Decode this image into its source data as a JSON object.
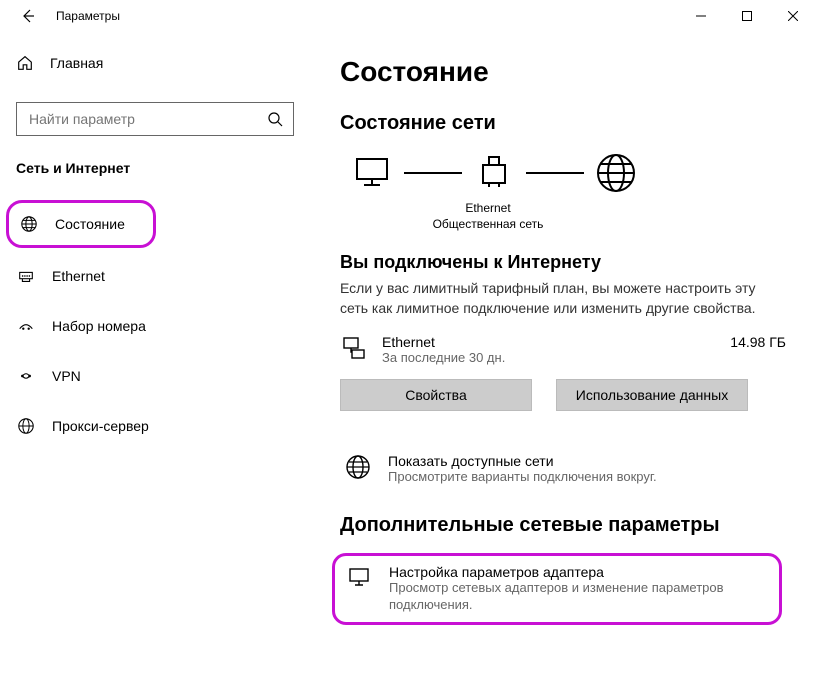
{
  "window": {
    "title": "Параметры"
  },
  "sidebar": {
    "home": "Главная",
    "search_placeholder": "Найти параметр",
    "category": "Сеть и Интернет",
    "items": [
      {
        "label": "Состояние"
      },
      {
        "label": "Ethernet"
      },
      {
        "label": "Набор номера"
      },
      {
        "label": "VPN"
      },
      {
        "label": "Прокси-сервер"
      }
    ]
  },
  "main": {
    "page_title": "Состояние",
    "status_heading": "Состояние сети",
    "diagram": {
      "label": "Ethernet",
      "subtype": "Общественная сеть"
    },
    "connected": {
      "title": "Вы подключены к Интернету",
      "desc": "Если у вас лимитный тарифный план, вы можете настроить эту сеть как лимитное подключение или изменить другие свойства.",
      "iface": "Ethernet",
      "period": "За последние 30 дн.",
      "usage": "14.98 ГБ",
      "btn_props": "Свойства",
      "btn_usage": "Использование данных"
    },
    "show_networks": {
      "title": "Показать доступные сети",
      "desc": "Просмотрите варианты подключения вокруг."
    },
    "advanced_heading": "Дополнительные сетевые параметры",
    "adapter": {
      "title": "Настройка параметров адаптера",
      "desc": "Просмотр сетевых адаптеров и изменение параметров подключения."
    }
  }
}
